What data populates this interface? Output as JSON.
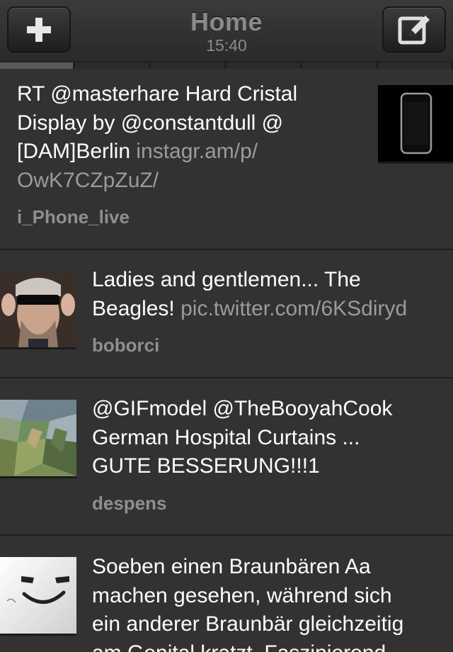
{
  "header": {
    "title": "Home",
    "time": "15:40",
    "left_button_icon": "plus-icon",
    "right_button_icon": "compose-icon"
  },
  "tabs": {
    "count": 6,
    "active_index": 0
  },
  "tweets": [
    {
      "text_lines": [
        "RT @masterhare Hard Cristal",
        "Display by @constantdull @",
        "[DAM]Berlin "
      ],
      "link": "instagr.am/p/",
      "link2": "OwK7CZpZuZ/",
      "user": "i_Phone_live",
      "thumb_icon": "iphone-thumbnail"
    },
    {
      "text_lines": [
        "Ladies and gentlemen... The",
        "Beagles! "
      ],
      "link": "pic.twitter.com/6KSdiryd",
      "user": "boborci",
      "thumb_icon": "avatar-sunglasses"
    },
    {
      "text_lines": [
        "@GIFmodel @TheBooyahCook",
        "German Hospital Curtains ...",
        "GUTE BESSERUNG!!!1"
      ],
      "user": "despens",
      "thumb_icon": "avatar-camo-pattern"
    },
    {
      "text_lines": [
        "Soeben einen Braunbären Aa",
        "machen gesehen, während sich",
        "ein anderer Braunbär gleichzeitig",
        "am Genital kratzt. Faszinierend"
      ],
      "user": "",
      "thumb_icon": "avatar-smiley-box"
    }
  ]
}
